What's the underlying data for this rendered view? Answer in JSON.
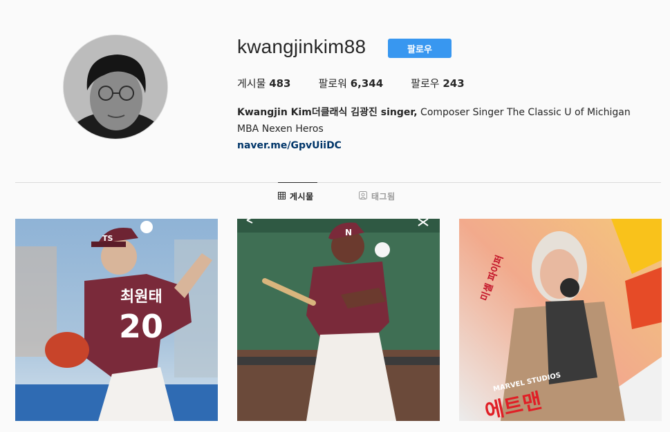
{
  "profile": {
    "username": "kwangjinkim88",
    "follow_label": "팔로우",
    "stats": [
      {
        "label": "게시물",
        "value": "483"
      },
      {
        "label": "팔로워",
        "value": "6,344"
      },
      {
        "label": "팔로우",
        "value": "243"
      }
    ],
    "bio_name": "Kwangjin Kim더클래식 김광진 singer,",
    "bio_text": " Composer Singer The Classic U of Michigan MBA Nexen Heros",
    "link": "naver.me/GpvUiiDC"
  },
  "tabs": [
    {
      "label": "게시물",
      "icon": "grid-icon",
      "active": true
    },
    {
      "label": "태그됨",
      "icon": "tag-icon",
      "active": false
    }
  ],
  "posts": [
    {
      "jersey_name": "최원태",
      "jersey_number": "20",
      "cap_text": "TS"
    },
    {
      "cap_text": "N"
    },
    {
      "poster_title": "에트맨",
      "poster_brand": "MARVEL STUDIOS",
      "poster_side": "미셸 파이퍼"
    }
  ],
  "colors": {
    "accent": "#3897f0",
    "link": "#003569",
    "team_maroon": "#7a2a3a"
  }
}
